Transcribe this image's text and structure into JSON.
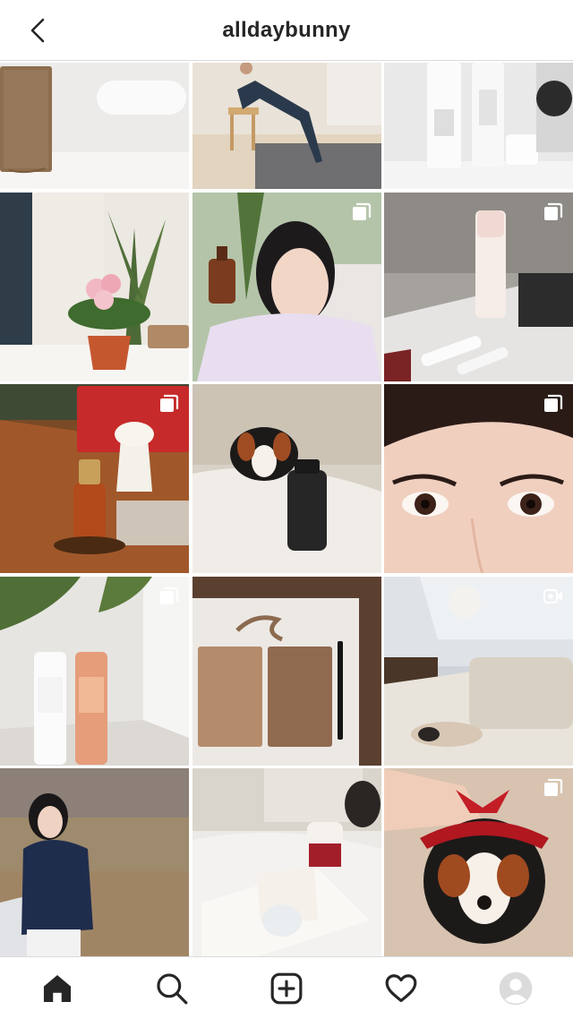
{
  "header": {
    "title": "alldaybunny",
    "back_icon": "chevron-left-icon"
  },
  "grid": {
    "posts": [
      {
        "id": "post-notebook-lamp",
        "multi": false,
        "video": false
      },
      {
        "id": "post-yoga",
        "multi": false,
        "video": false
      },
      {
        "id": "post-skincare-bottles",
        "multi": false,
        "video": false
      },
      {
        "id": "post-pink-flower",
        "multi": false,
        "video": false
      },
      {
        "id": "post-selfie-serum",
        "multi": true,
        "video": false
      },
      {
        "id": "post-athe-products",
        "multi": true,
        "video": false
      },
      {
        "id": "post-serum-mushroom-lamp",
        "multi": true,
        "video": false
      },
      {
        "id": "post-dog-bottle",
        "multi": false,
        "video": false
      },
      {
        "id": "post-eyes-closeup",
        "multi": true,
        "video": false
      },
      {
        "id": "post-clarins",
        "multi": true,
        "video": false
      },
      {
        "id": "post-notebooks-pen",
        "multi": false,
        "video": false
      },
      {
        "id": "post-dog-sofa",
        "multi": false,
        "video": true
      },
      {
        "id": "post-winter-portrait",
        "multi": false,
        "video": false
      },
      {
        "id": "post-book-mug",
        "multi": false,
        "video": false
      },
      {
        "id": "post-dog-red-bow",
        "multi": true,
        "video": false
      }
    ]
  },
  "bottom_nav": {
    "items": [
      {
        "name": "home",
        "icon": "home-icon"
      },
      {
        "name": "search",
        "icon": "search-icon"
      },
      {
        "name": "new-post",
        "icon": "plus-square-icon"
      },
      {
        "name": "activity",
        "icon": "heart-icon"
      },
      {
        "name": "profile",
        "icon": "avatar-icon"
      }
    ]
  },
  "colors": {
    "text": "#262626",
    "border": "#dbdbdb",
    "background": "#ffffff"
  }
}
